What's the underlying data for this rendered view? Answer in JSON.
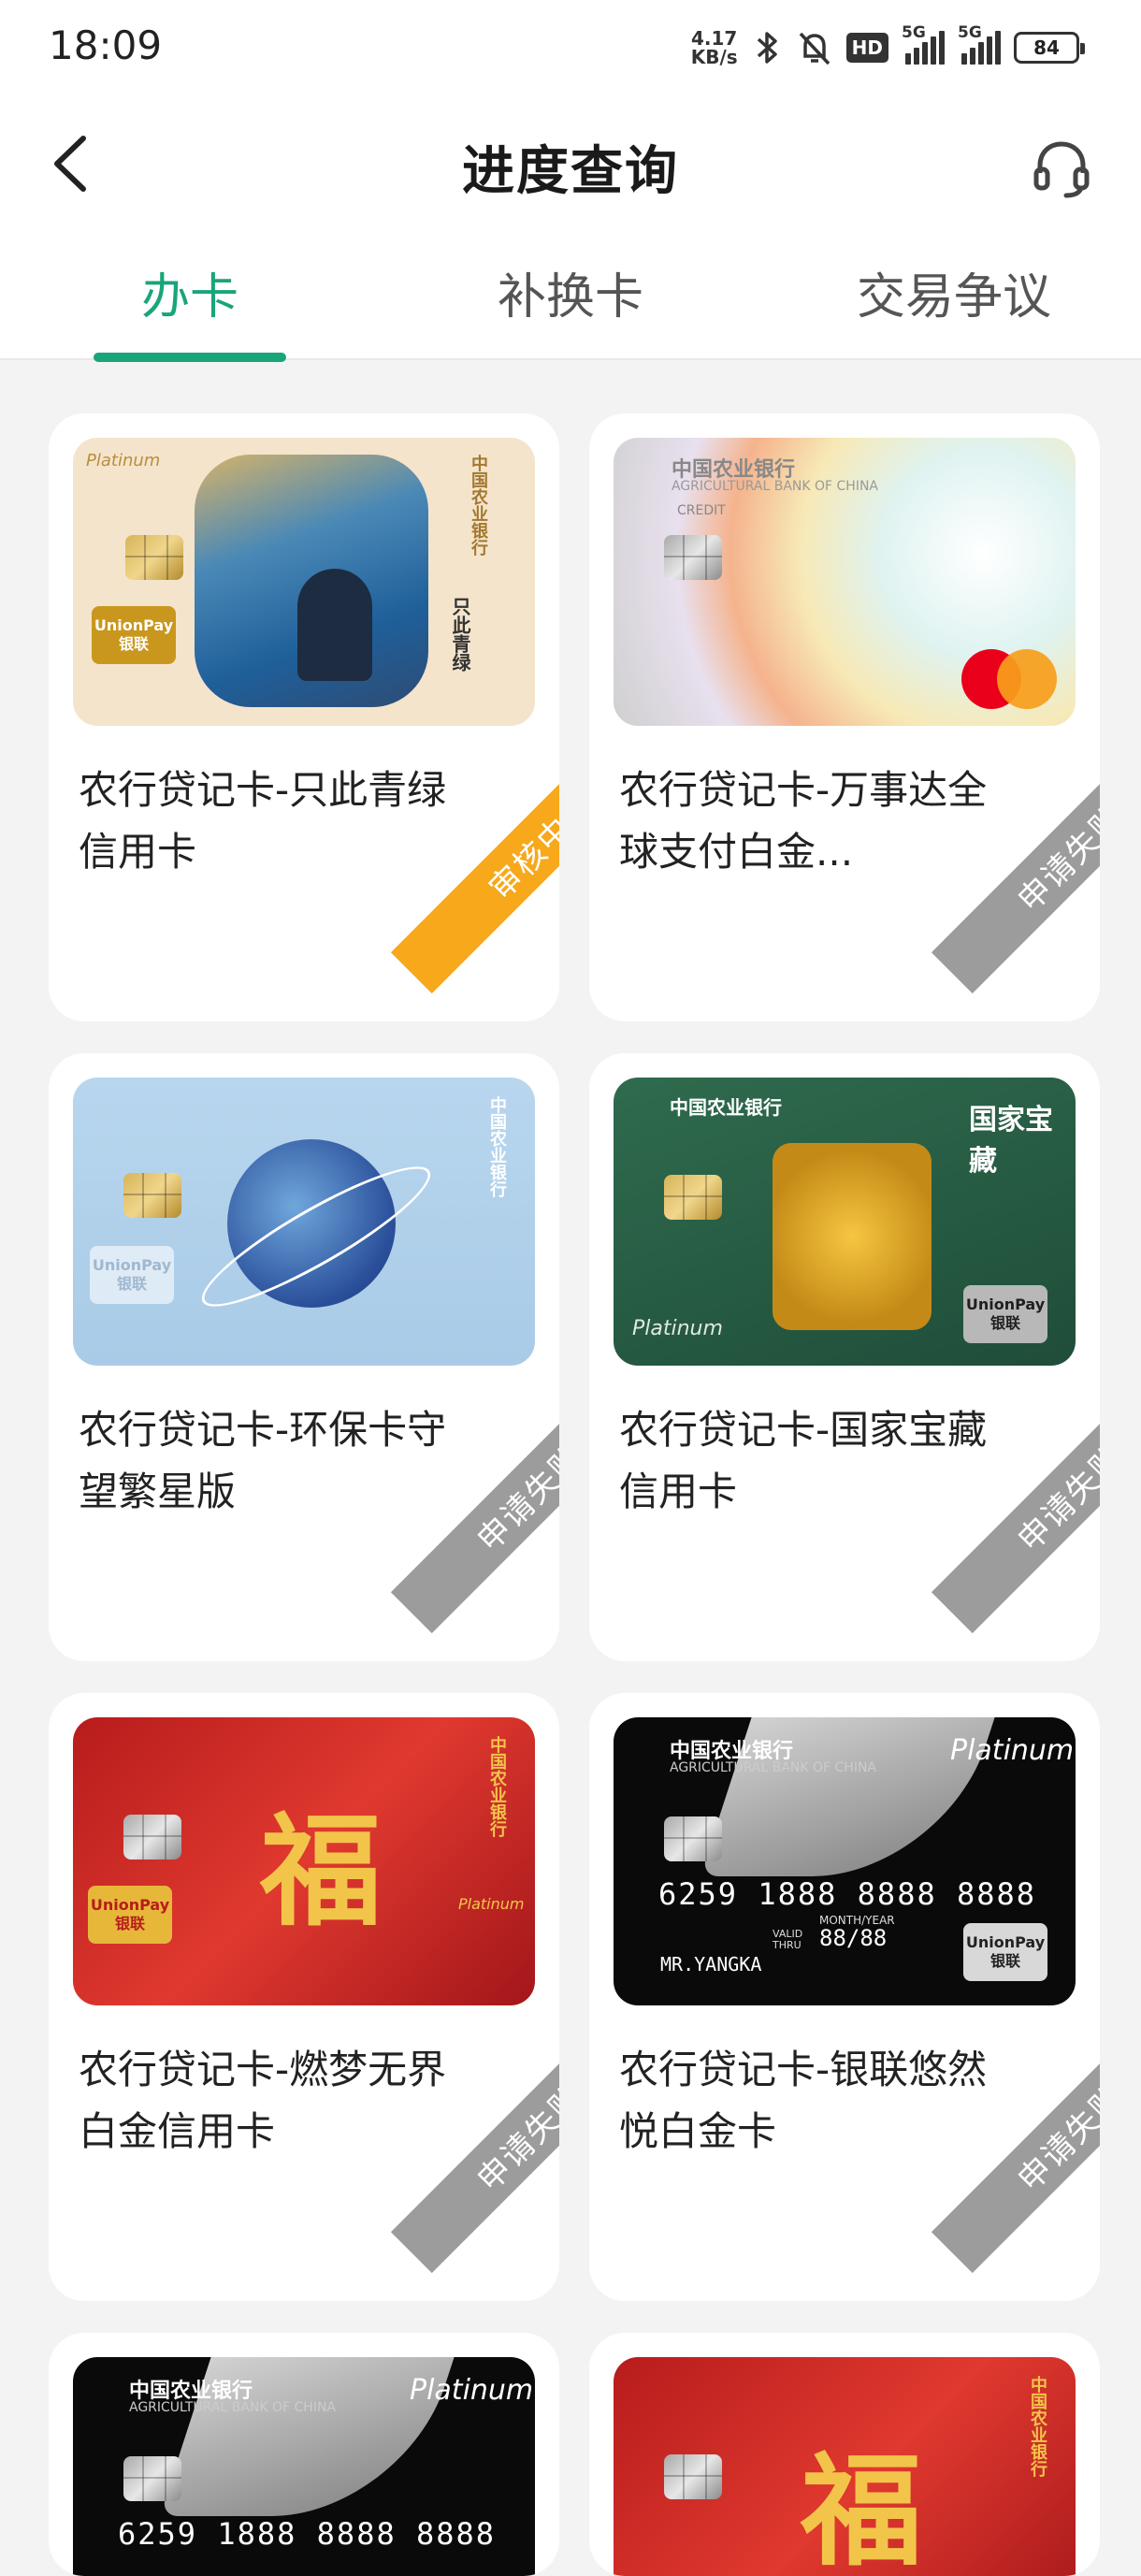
{
  "status_bar": {
    "time": "18:09",
    "net_speed_value": "4.17",
    "net_speed_unit": "KB/s",
    "hd_badge": "HD",
    "signal_1_label": "5G",
    "signal_2_label": "5G",
    "battery": "84"
  },
  "nav": {
    "title": "进度查询",
    "back_icon": "chevron-left-icon",
    "service_icon": "headset-icon"
  },
  "tabs": [
    {
      "label": "办卡",
      "active": true
    },
    {
      "label": "补换卡",
      "active": false
    },
    {
      "label": "交易争议",
      "active": false
    }
  ],
  "colors": {
    "accent": "#18a57a",
    "pending": "#f7a81b",
    "failed": "#9c9c9c"
  },
  "cards": [
    {
      "name": "农行贷记卡-只此青绿信用卡",
      "status": "审核中"
    },
    {
      "name": "农行贷记卡-万事达全球支付白金...",
      "status": "申请失败"
    },
    {
      "name": "农行贷记卡-环保卡守望繁星版",
      "status": "申请失败"
    },
    {
      "name": "农行贷记卡-国家宝藏信用卡",
      "status": "申请失败"
    },
    {
      "name": "农行贷记卡-燃梦无界白金信用卡",
      "status": "申请失败"
    },
    {
      "name": "农行贷记卡-银联悠然悦白金卡",
      "status": "申请失败"
    }
  ],
  "card_art": {
    "bank_cn": "中国农业银行",
    "bank_en": "AGRICULTURAL BANK OF CHINA",
    "credit": "CREDIT",
    "platinum": "Platinum",
    "unionpay_en": "UnionPay",
    "unionpay_cn": "银联",
    "card_number": "6259 1888 8888 8888",
    "month_year": "MONTH/YEAR",
    "valid_thru": "VALID THRU",
    "expiry": "88/88",
    "holder": "MR.YANGKA",
    "fu_char": "福",
    "qingl_label": "只此青绿",
    "treasure_label": "国家宝藏"
  }
}
